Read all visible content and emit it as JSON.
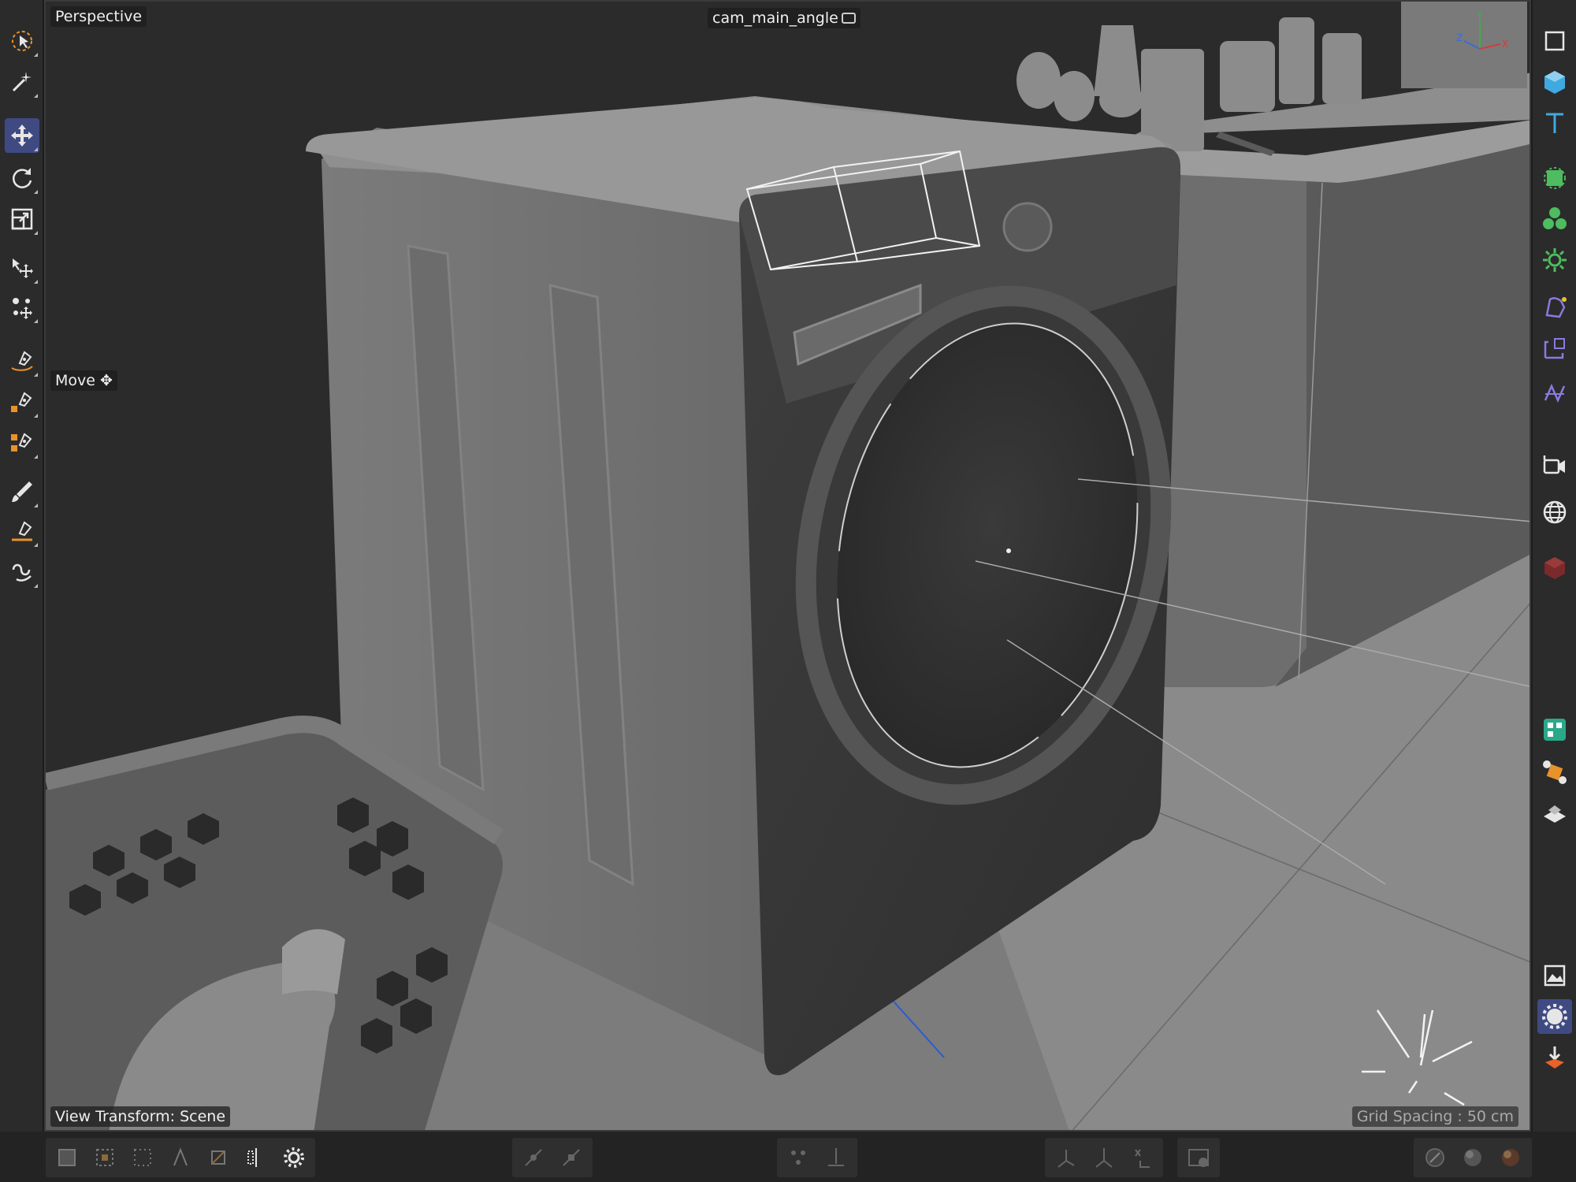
{
  "viewport": {
    "title": "Perspective",
    "camera_name": "cam_main_angle",
    "active_tool_label": "Move",
    "view_transform": "View Transform: Scene",
    "grid_spacing": "Grid Spacing : 50 cm",
    "axis_labels": {
      "x": "X",
      "y": "Y",
      "z": "Z"
    }
  },
  "left_toolbar": [
    {
      "icon": "live-selection-icon",
      "active": false
    },
    {
      "icon": "magic-wand-icon",
      "active": false
    },
    {
      "icon": "move-icon",
      "active": true
    },
    {
      "icon": "rotate-icon",
      "active": false
    },
    {
      "icon": "scale-icon",
      "active": false
    },
    {
      "icon": "transform-icon",
      "active": false
    },
    {
      "icon": "soft-move-icon",
      "active": false
    },
    {
      "icon": "spline-pen-icon",
      "active": false
    },
    {
      "icon": "spline-sketch-icon",
      "active": false
    },
    {
      "icon": "spline-smooth-icon",
      "active": false
    },
    {
      "icon": "brush-icon",
      "active": false
    },
    {
      "icon": "edge-pen-icon",
      "active": false
    },
    {
      "icon": "arc-icon",
      "active": false
    }
  ],
  "right_toolbar": [
    {
      "icon": "null-object-icon"
    },
    {
      "icon": "cube-icon"
    },
    {
      "icon": "text-icon"
    },
    {
      "icon": "subdivision-icon"
    },
    {
      "icon": "cloner-icon"
    },
    {
      "icon": "effector-icon"
    },
    {
      "icon": "deformer-icon"
    },
    {
      "icon": "field-icon"
    },
    {
      "icon": "volume-icon"
    },
    {
      "icon": "camera-icon"
    },
    {
      "icon": "environment-icon"
    },
    {
      "icon": "redshift-icon"
    },
    {
      "icon": "scene-nodes-icon"
    },
    {
      "icon": "dynamics-icon"
    },
    {
      "icon": "floor-icon"
    },
    {
      "icon": "picture-viewer-icon"
    },
    {
      "icon": "render-settings-icon"
    },
    {
      "icon": "render-icon"
    }
  ],
  "colors": {
    "accent": "#3f4a83",
    "tool_icon": "#c8c8c8",
    "orange": "#e8922a",
    "green": "#4dbd5f",
    "purple": "#8a7ae0",
    "cyan": "#3fa9e0"
  }
}
